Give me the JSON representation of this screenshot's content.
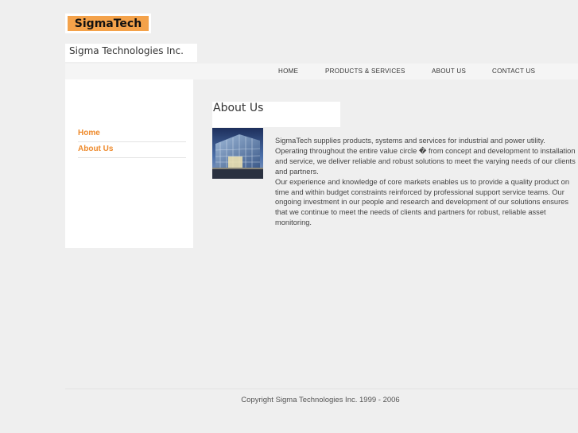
{
  "brand": {
    "logo_text": "SigmaTech",
    "company_name": "Sigma Technologies Inc."
  },
  "nav": {
    "items": [
      {
        "label": "HOME"
      },
      {
        "label": "PRODUCTS & SERVICES"
      },
      {
        "label": "ABOUT US"
      },
      {
        "label": "CONTACT US"
      }
    ]
  },
  "sidebar": {
    "links": [
      {
        "label": "Home"
      },
      {
        "label": "About Us"
      }
    ]
  },
  "main": {
    "title": "About Us",
    "paragraphs": [
      "SigmaTech supplies products, systems and services for industrial and power utility. Operating throughout the entire value circle � from concept and development to installation and service, we deliver reliable and robust solutions to meet the varying needs of our clients and partners.",
      "Our experience and knowledge of core markets enables us to provide a quality product on time and within budget constraints reinforced by professional support service teams. Our ongoing investment in our people and research and development of our solutions ensures that we continue to meet the needs of clients and partners for robust, reliable asset monitoring."
    ]
  },
  "footer": {
    "copyright": "Copyright Sigma Technologies Inc. 1999 - 2006"
  },
  "colors": {
    "accent": "#ee8a2c",
    "logo_bg": "#f4a24a",
    "background": "#efefef"
  }
}
